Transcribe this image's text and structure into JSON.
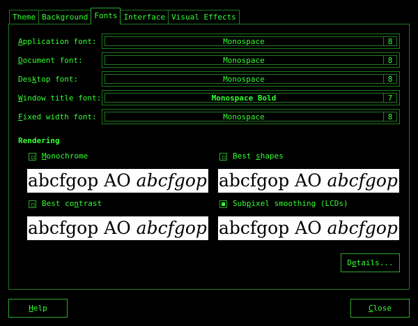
{
  "tabs": [
    {
      "label": "Theme"
    },
    {
      "label": "Background"
    },
    {
      "label": "Fonts"
    },
    {
      "label": "Interface"
    },
    {
      "label": "Visual Effects"
    }
  ],
  "active_tab": "Fonts",
  "fonts": [
    {
      "pre": "",
      "mn": "A",
      "post": "pplication font:",
      "font": "Monospace",
      "size": "8",
      "bold": false
    },
    {
      "pre": "",
      "mn": "D",
      "post": "ocument font:",
      "font": "Monospace",
      "size": "8",
      "bold": false
    },
    {
      "pre": "Des",
      "mn": "k",
      "post": "top font:",
      "font": "Monospace",
      "size": "8",
      "bold": false
    },
    {
      "pre": "",
      "mn": "W",
      "post": "indow title font:",
      "font": "Monospace Bold",
      "size": "7",
      "bold": true
    },
    {
      "pre": "",
      "mn": "F",
      "post": "ixed width font:",
      "font": "Monospace",
      "size": "8",
      "bold": false
    }
  ],
  "rendering": {
    "title": "Rendering",
    "options": [
      {
        "pre": "",
        "mn": "M",
        "post": "onochrome",
        "checked": false
      },
      {
        "pre": "Best ",
        "mn": "s",
        "post": "hapes",
        "checked": false
      },
      {
        "pre": "Best co",
        "mn": "n",
        "post": "trast",
        "checked": false
      },
      {
        "pre": "Sub",
        "mn": "p",
        "post": "ixel smoothing (LCDs)",
        "checked": true
      }
    ],
    "preview_plain": "abcfgop AO ",
    "preview_italic": "abcfgop"
  },
  "buttons": {
    "details": {
      "pre": "D",
      "mn": "e",
      "post": "tails..."
    },
    "help": {
      "pre": "",
      "mn": "H",
      "post": "elp"
    },
    "close": {
      "pre": "",
      "mn": "C",
      "post": "lose"
    }
  }
}
